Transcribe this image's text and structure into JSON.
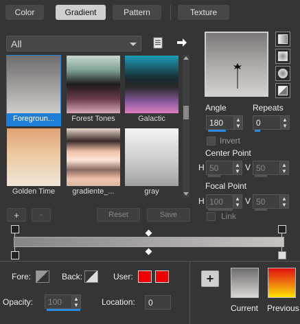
{
  "tabs": [
    {
      "label": "Color"
    },
    {
      "label": "Gradient"
    },
    {
      "label": "Pattern"
    },
    {
      "label": "Texture"
    }
  ],
  "category_select": {
    "value": "All"
  },
  "gradients": [
    {
      "name": "Foregroun...",
      "selected": true
    },
    {
      "name": "Forest Tones"
    },
    {
      "name": "Galactic"
    },
    {
      "name": "Golden Time"
    },
    {
      "name": "gradiente_..."
    },
    {
      "name": "gray"
    }
  ],
  "list_buttons": {
    "add": "+",
    "remove": "-",
    "reset": "Reset",
    "save": "Save"
  },
  "angle": {
    "label": "Angle",
    "value": "180"
  },
  "repeats": {
    "label": "Repeats",
    "value": "0"
  },
  "invert": {
    "label": "Invert",
    "checked": false
  },
  "center_point": {
    "label": "Center Point",
    "h_label": "H",
    "h_value": "50",
    "v_label": "V",
    "v_value": "50"
  },
  "focal_point": {
    "label": "Focal Point",
    "h_label": "H",
    "h_value": "100",
    "v_label": "V",
    "v_value": "50"
  },
  "link": {
    "label": "Link",
    "checked": false
  },
  "stops": {
    "fore_label": "Fore:",
    "back_label": "Back:",
    "user_label": "User:",
    "opacity_label": "Opacity:",
    "opacity_value": "100",
    "location_label": "Location:",
    "location_value": "0",
    "user_color_1": "#ee0000",
    "user_color_2": "#ee0000"
  },
  "bottom": {
    "add_button": "+",
    "current_label": "Current",
    "previous_label": "Previous"
  },
  "icons": {
    "library": "book-icon",
    "arrow": "arrow-right-icon",
    "preview_marker": "center-point-marker-icon"
  }
}
